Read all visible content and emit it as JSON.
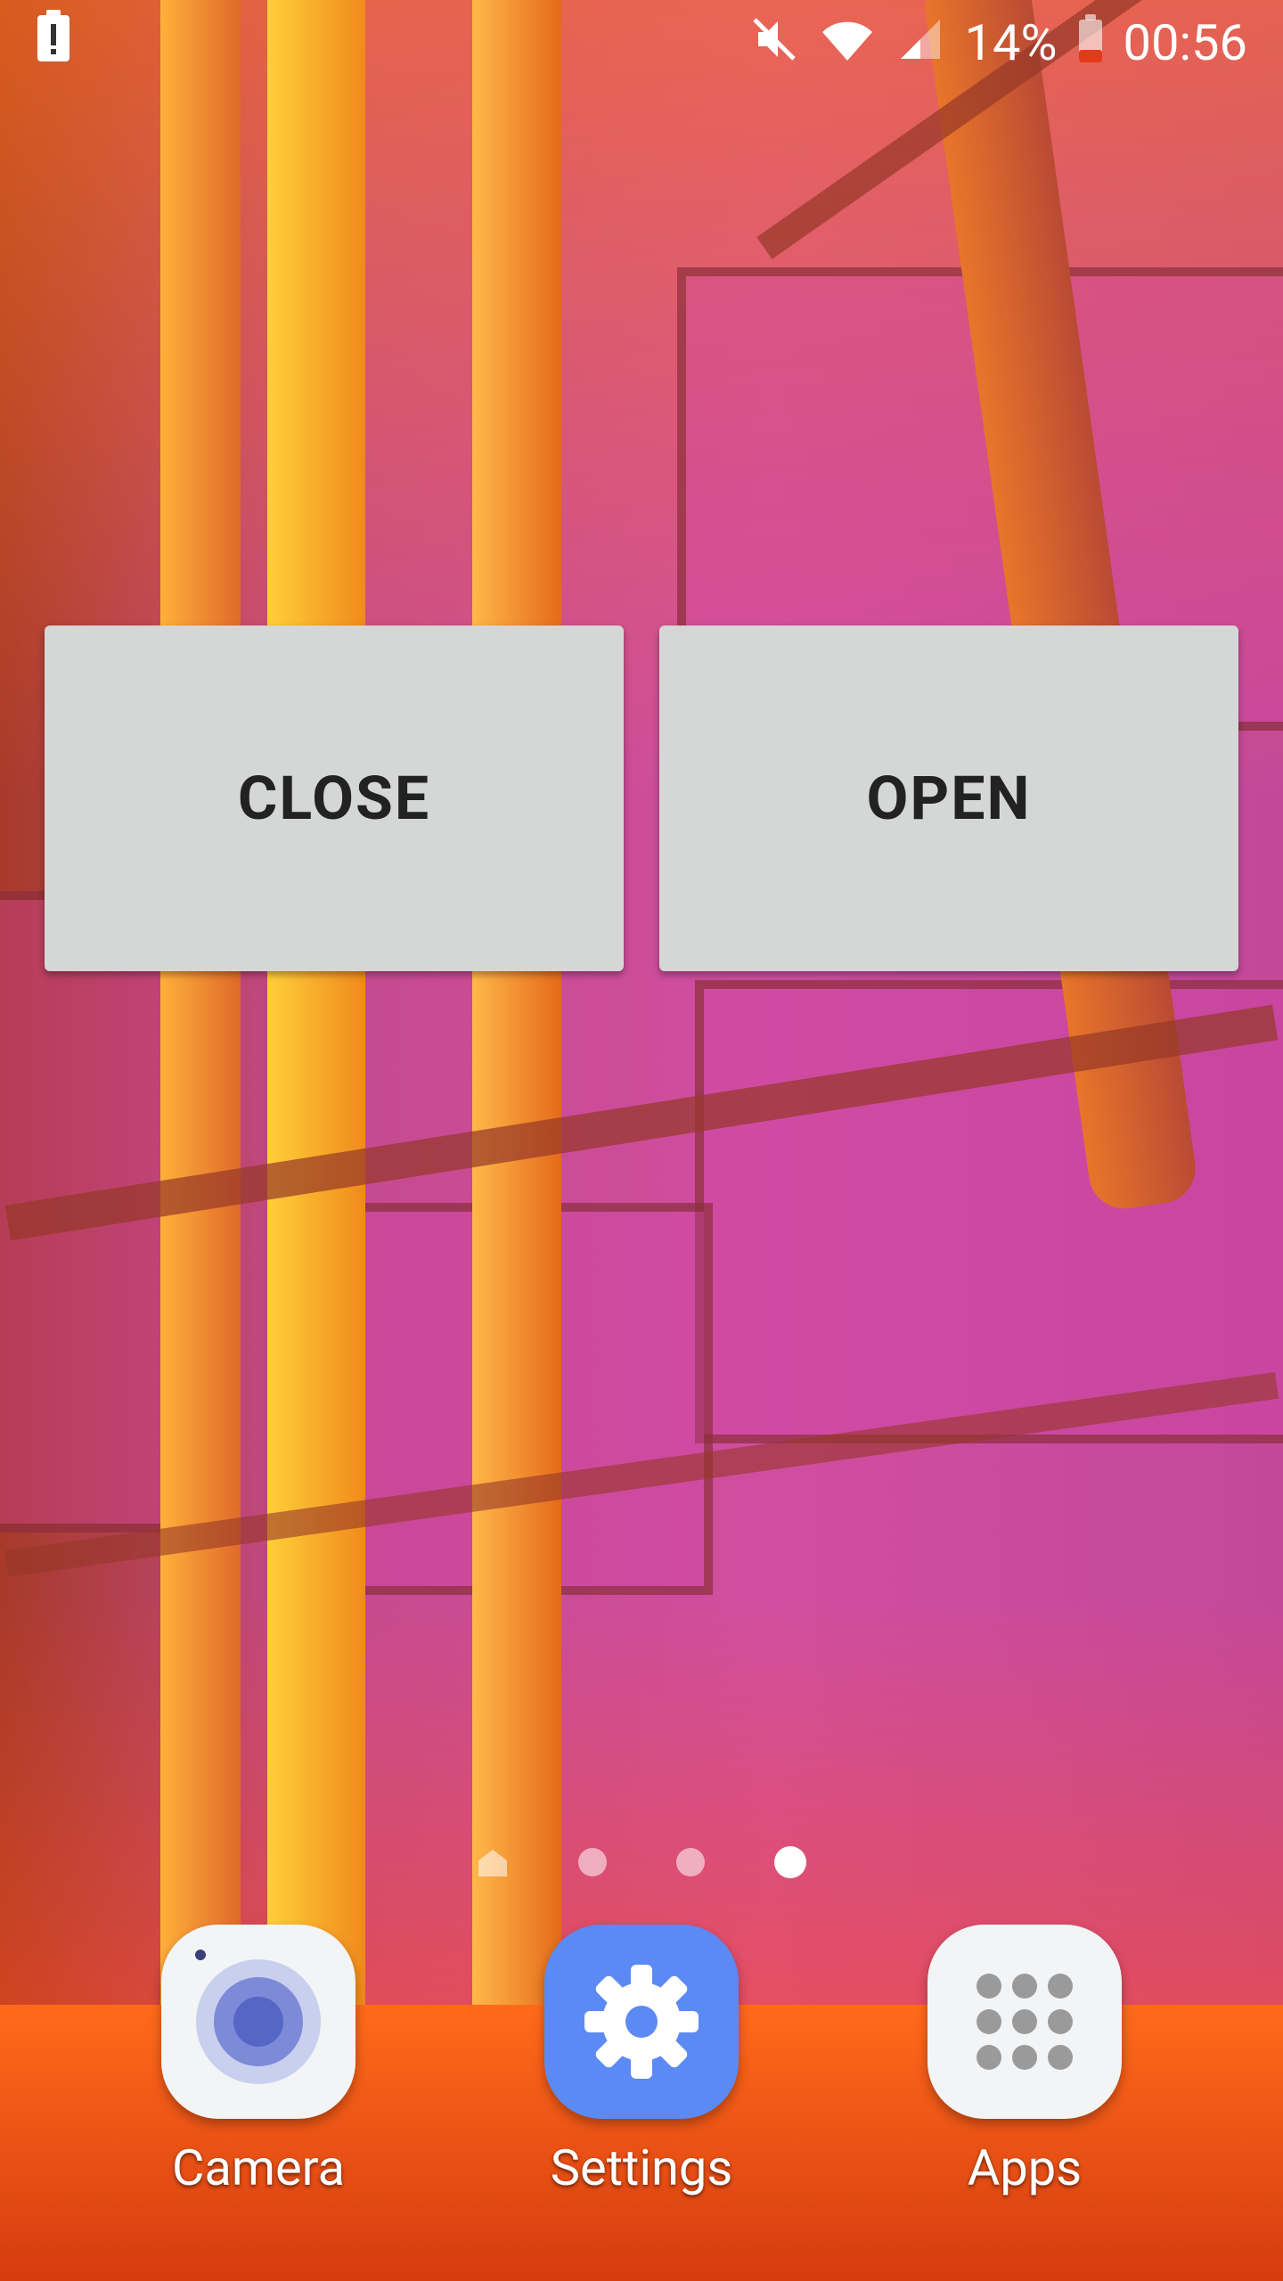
{
  "status_bar": {
    "battery_percent": "14%",
    "time": "00:56",
    "icons": [
      "battery-alert-icon",
      "mute-icon",
      "wifi-icon",
      "signal-icon",
      "battery-icon"
    ]
  },
  "widget": {
    "close_label": "CLOSE",
    "open_label": "OPEN"
  },
  "page_indicator": {
    "pages": 4,
    "active_index": 3
  },
  "dock": {
    "apps": [
      {
        "label": "Camera",
        "icon": "camera-icon"
      },
      {
        "label": "Settings",
        "icon": "gear-icon"
      },
      {
        "label": "Apps",
        "icon": "apps-grid-icon"
      }
    ]
  },
  "colors": {
    "button_bg": "#d5d6d6",
    "settings_bg": "#5b8af5"
  }
}
